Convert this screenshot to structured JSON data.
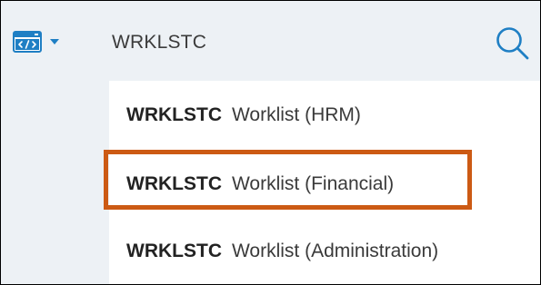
{
  "search": {
    "query": "WRKLSTC"
  },
  "results": [
    {
      "code": "WRKLSTC",
      "description": "Worklist (HRM)"
    },
    {
      "code": "WRKLSTC",
      "description": "Worklist (Financial)"
    },
    {
      "code": "WRKLSTC",
      "description": "Worklist (Administration)"
    }
  ],
  "icons": {
    "app_switcher": "code-icon",
    "dropdown": "caret-down-icon",
    "search": "search-icon"
  },
  "colors": {
    "background": "#edf1f5",
    "accent": "#1f7fc4",
    "highlight": "#cc5a14"
  }
}
